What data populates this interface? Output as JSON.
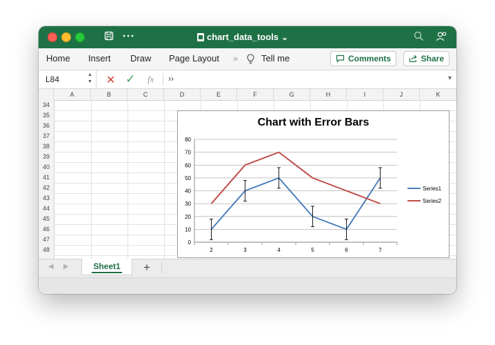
{
  "window": {
    "title": "chart_data_tools",
    "title_chevron": "⌄",
    "save_icon": "floppy-disk-icon",
    "more_icon": "ellipsis-icon"
  },
  "ribbon": {
    "tabs": [
      "Home",
      "Insert",
      "Draw",
      "Page Layout"
    ],
    "overflow": "»",
    "tell_me": "Tell me",
    "comments": "Comments",
    "share": "Share"
  },
  "formula_bar": {
    "name_box": "L84",
    "fx": "fx",
    "expand": "››",
    "cancel_symbol": "✕",
    "confirm_symbol": "✓",
    "dropdown": "▾"
  },
  "sheet": {
    "columns": [
      "A",
      "B",
      "C",
      "D",
      "E",
      "F",
      "G",
      "H",
      "I",
      "J",
      "K"
    ],
    "rows": [
      "34",
      "35",
      "36",
      "37",
      "38",
      "39",
      "40",
      "41",
      "42",
      "43",
      "44",
      "45",
      "46",
      "47",
      "48"
    ],
    "tabs": [
      "Sheet1"
    ],
    "add_tab": "+"
  },
  "colors": {
    "brand": "#1e7145",
    "series1": "#4a7ebb",
    "series2": "#be4b48"
  },
  "chart_data": {
    "type": "line",
    "title": "Chart with Error Bars",
    "categories": [
      "2",
      "3",
      "4",
      "5",
      "6",
      "7"
    ],
    "series": [
      {
        "name": "Series1",
        "values": [
          10,
          40,
          50,
          20,
          10,
          50
        ],
        "error": 8,
        "color": "#4a7ebb"
      },
      {
        "name": "Series2",
        "values": [
          30,
          60,
          70,
          50,
          40,
          30
        ],
        "color": "#be4b48"
      }
    ],
    "ylim": [
      0,
      80
    ],
    "yticks": [
      0,
      10,
      20,
      30,
      40,
      50,
      60,
      70,
      80
    ],
    "grid": true,
    "legend": "right"
  }
}
